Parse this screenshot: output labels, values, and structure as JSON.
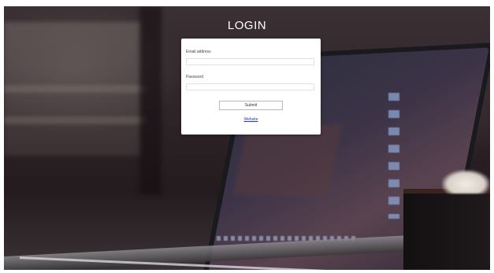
{
  "login": {
    "title": "LOGIN",
    "email_label": "Email address",
    "email_value": "",
    "password_label": "Password",
    "password_value": "",
    "submit_label": "Submit",
    "website_link": "Website"
  },
  "colors": {
    "card_background": "#ffffff",
    "title_text": "#ffffff",
    "link": "#2b3aa8"
  },
  "background": {
    "image": "laptop-on-desk-photo"
  }
}
